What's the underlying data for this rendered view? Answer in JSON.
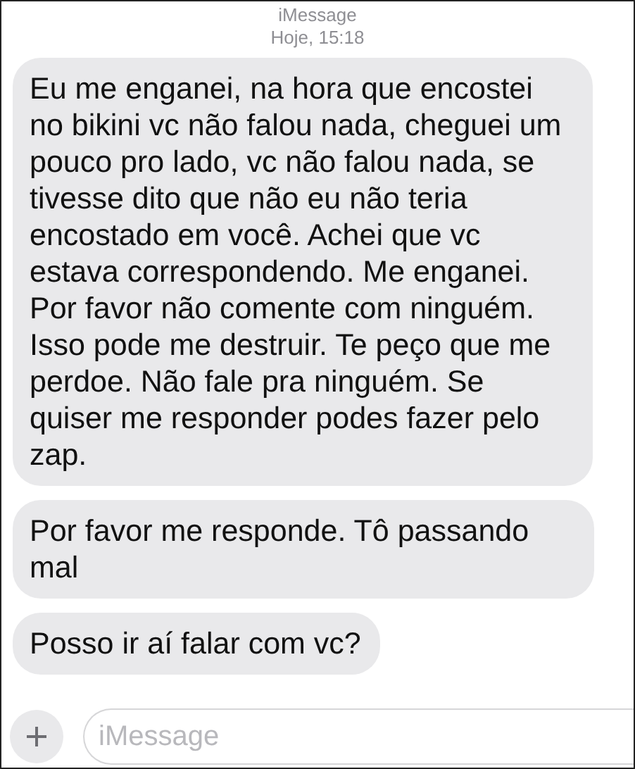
{
  "header": {
    "service": "iMessage",
    "timestamp": "Hoje, 15:18"
  },
  "messages": [
    {
      "text": "Eu me enganei, na hora que encostei no bikini vc não falou nada, cheguei um pouco pro lado, vc não falou nada, se tivesse dito que não eu não teria encostado em você. Achei que vc estava correspondendo. Me enganei. Por favor não comente com ninguém. Isso pode me destruir. Te peço que me perdoe. Não fale pra ninguém. Se quiser me responder podes fazer pelo zap."
    },
    {
      "text": "Por favor me responde. Tô passando mal"
    },
    {
      "text": "Posso ir aí falar com vc?"
    }
  ],
  "composer": {
    "placeholder": "iMessage"
  }
}
